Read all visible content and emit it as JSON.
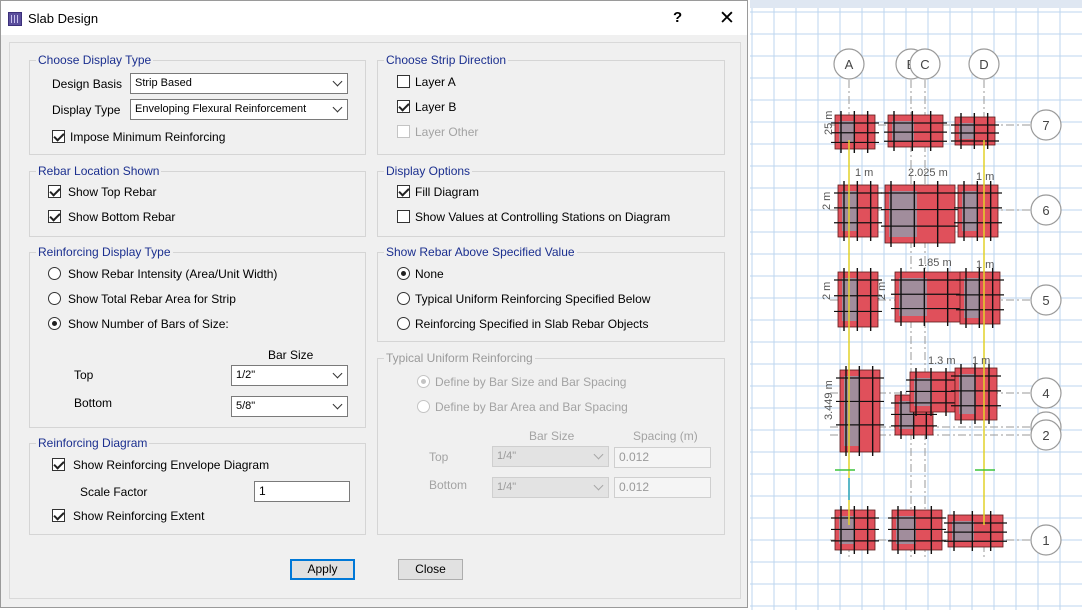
{
  "window": {
    "title": "Slab Design",
    "help_label": "?",
    "close_label": "✕"
  },
  "strip_direction": {
    "legend": "Choose Strip Direction",
    "layer_a": {
      "label": "Layer A",
      "checked": false
    },
    "layer_b": {
      "label": "Layer B",
      "checked": true
    },
    "layer_other": {
      "label": "Layer Other",
      "checked": false,
      "disabled": true
    }
  },
  "display_type": {
    "legend": "Choose Display Type",
    "design_basis_label": "Design Basis",
    "design_basis_value": "Strip Based",
    "display_type_label": "Display Type",
    "display_type_value": "Enveloping Flexural Reinforcement",
    "impose_min_label": "Impose Minimum Reinforcing",
    "impose_min_checked": true
  },
  "rebar_location": {
    "legend": "Rebar Location Shown",
    "top_label": "Show Top Rebar",
    "bottom_label": "Show Bottom Rebar"
  },
  "display_options": {
    "legend": "Display Options",
    "fill_label": "Fill Diagram",
    "fill_checked": true,
    "values_label": "Show Values at Controlling Stations on Diagram",
    "values_checked": false
  },
  "reinforcing_display": {
    "legend": "Reinforcing Display Type",
    "opt1": "Show Rebar Intensity (Area/Unit Width)",
    "opt2": "Show Total Rebar Area for Strip",
    "opt3": "Show Number of Bars of Size:",
    "selected": 3,
    "bar_size_header": "Bar Size",
    "top_label": "Top",
    "top_value": "1/2\"",
    "bottom_label": "Bottom",
    "bottom_value": "5/8\""
  },
  "show_rebar_above": {
    "legend": "Show Rebar Above Specified Value",
    "opt1": "None",
    "opt2": "Typical Uniform Reinforcing Specified Below",
    "opt3": "Reinforcing Specified in Slab Rebar Objects",
    "selected": 1
  },
  "typical_uniform": {
    "legend": "Typical Uniform Reinforcing",
    "opt1": "Define by Bar Size and Bar Spacing",
    "opt2": "Define by Bar Area and Bar Spacing",
    "bar_size_header": "Bar Size",
    "spacing_header": "Spacing  (m)",
    "top_label": "Top",
    "top_bar": "1/4\"",
    "top_spacing": "0.012",
    "bottom_label": "Bottom",
    "bottom_bar": "1/4\"",
    "bottom_spacing": "0.012"
  },
  "reinforcing_diagram": {
    "legend": "Reinforcing Diagram",
    "envelope_label": "Show Reinforcing Envelope Diagram",
    "scale_label": "Scale Factor",
    "scale_value": "1",
    "extent_label": "Show Reinforcing Extent"
  },
  "buttons": {
    "apply": "Apply",
    "close": "Close"
  },
  "plan_view": {
    "grid_labels": [
      "A",
      "B",
      "C",
      "D"
    ],
    "row_labels": [
      "7",
      "6",
      "5",
      "4",
      "3",
      "2",
      "1"
    ],
    "dims": [
      "1 m",
      "2.025 m",
      "1 m",
      "1.85 m",
      "1 m",
      "1.3 m",
      "1 m",
      "2 m",
      "2 m",
      "2 m",
      "3.449 m",
      "25 m"
    ],
    "colors": {
      "grid": "#bcd6ef",
      "slab": "#e0505b",
      "axis": "#9a9a9a",
      "bar": "#111111"
    }
  }
}
